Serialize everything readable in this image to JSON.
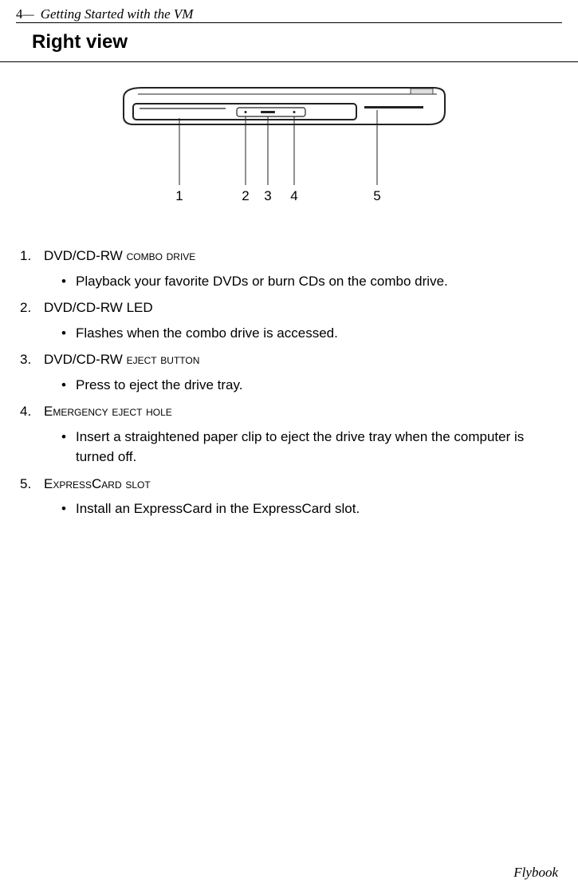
{
  "header": {
    "page_num": "4",
    "separator": " —  ",
    "chapter_title": "Getting Started with the VM"
  },
  "section_title": "Right view",
  "diagram": {
    "callouts": [
      "1",
      "2",
      "3",
      "4",
      "5"
    ]
  },
  "items": [
    {
      "num": "1.",
      "title_prefix": "DVD/CD-RW ",
      "title_smallcaps": "combo drive",
      "bullet": "Playback your favorite DVDs or burn CDs on the combo drive."
    },
    {
      "num": "2.",
      "title_prefix": "DVD/CD-RW LED",
      "title_smallcaps": "",
      "bullet": "Flashes when the combo drive is accessed."
    },
    {
      "num": "3.",
      "title_prefix": "DVD/CD-RW ",
      "title_smallcaps": "eject button",
      "bullet": "Press to eject the drive tray."
    },
    {
      "num": "4.",
      "title_prefix": "",
      "title_smallcaps": "Emergency eject hole",
      "bullet": "Insert a straightened paper clip to eject the drive tray when the computer is turned off."
    },
    {
      "num": "5.",
      "title_prefix": "",
      "title_smallcaps": "ExpressCard slot",
      "bullet": "Install an ExpressCard in the ExpressCard slot."
    }
  ],
  "footer": "Flybook"
}
